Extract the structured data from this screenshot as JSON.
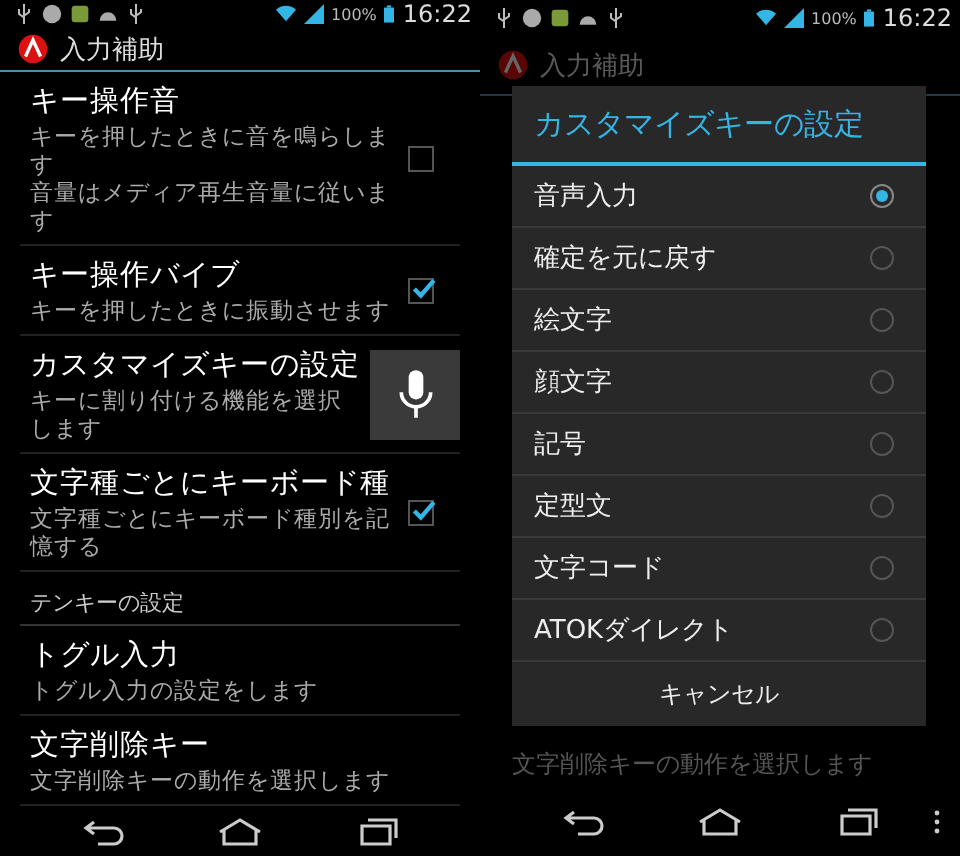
{
  "screens": [
    {
      "status_bar": {
        "battery": "100%",
        "time": "16:22"
      },
      "app_title": "入力補助",
      "items": [
        {
          "kind": "checkbox",
          "title": "キー操作音",
          "summary_lines": [
            "キーを押したときに音を鳴らします",
            "音量はメディア再生音量に従います"
          ],
          "checked": false
        },
        {
          "kind": "checkbox",
          "title": "キー操作バイブ",
          "summary": "キーを押したときに振動させます",
          "checked": true
        },
        {
          "kind": "icon",
          "title": "カスタマイズキーの設定",
          "summary": "キーに割り付ける機能を選択します"
        },
        {
          "kind": "checkbox",
          "title": "文字種ごとにキーボード種",
          "summary": "文字種ごとにキーボード種別を記憶する",
          "checked": true
        },
        {
          "kind": "category",
          "title": "テンキーの設定"
        },
        {
          "kind": "plain",
          "title": "トグル入力",
          "summary": "トグル入力の設定をします"
        },
        {
          "kind": "plain",
          "title": "文字削除キー",
          "summary": "文字削除キーの動作を選択します"
        }
      ]
    },
    {
      "status_bar": {
        "battery": "100%",
        "time": "16:22"
      },
      "app_title": "入力補助",
      "background_summary": "文字削除キーの動作を選択します",
      "dialog": {
        "title": "カスタマイズキーの設定",
        "options": [
          {
            "label": "音声入力",
            "selected": true
          },
          {
            "label": "確定を元に戻す",
            "selected": false
          },
          {
            "label": "絵文字",
            "selected": false
          },
          {
            "label": "顔文字",
            "selected": false
          },
          {
            "label": "記号",
            "selected": false
          },
          {
            "label": "定型文",
            "selected": false
          },
          {
            "label": "文字コード",
            "selected": false
          },
          {
            "label": "ATOKダイレクト",
            "selected": false
          }
        ],
        "cancel": "キャンセル"
      }
    }
  ]
}
